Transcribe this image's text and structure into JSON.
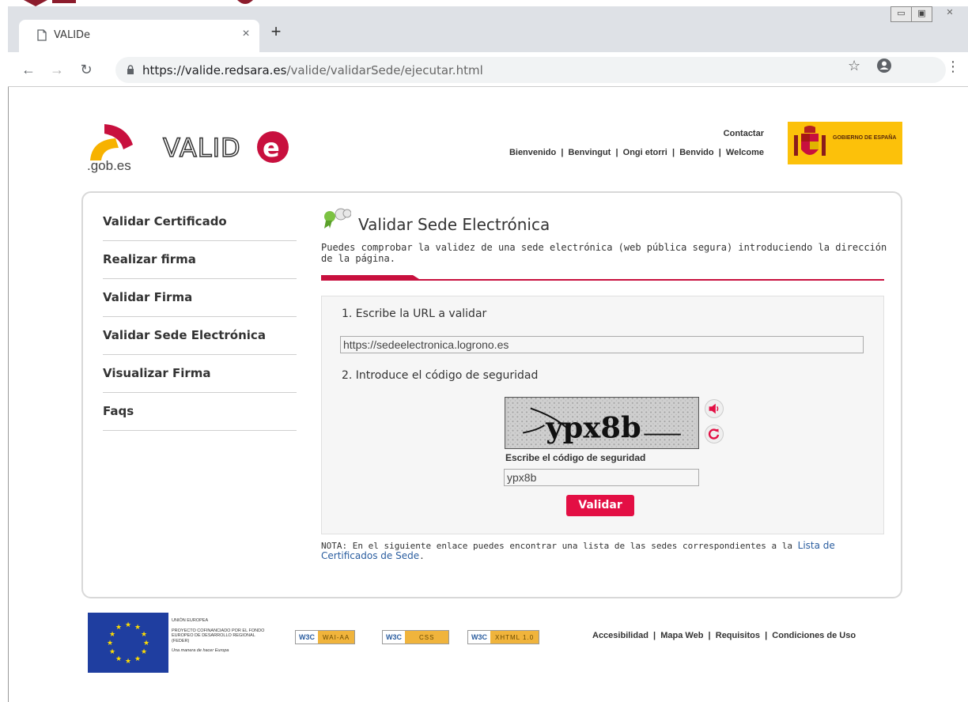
{
  "browser": {
    "tab_title": "VALIDe",
    "tab_close": "×",
    "new_tab": "+",
    "url_host": "https://valide.redsara.es",
    "url_path": "/valide/validarSede/ejecutar.html",
    "window_controls": {
      "minimize": "▭",
      "maximize": "▣",
      "close": "✕"
    }
  },
  "header": {
    "logo_suffix": ".gob.es",
    "logo_text": "VALIDe",
    "contact": "Contactar",
    "languages": [
      "Bienvenido",
      "Benvingut",
      "Ongi etorri",
      "Benvido",
      "Welcome"
    ],
    "government_badge": "GOBIERNO DE ESPAÑA"
  },
  "sidebar": {
    "items": [
      {
        "label": "Validar Certificado"
      },
      {
        "label": "Realizar firma"
      },
      {
        "label": "Validar Firma"
      },
      {
        "label": "Validar Sede Electrónica"
      },
      {
        "label": "Visualizar Firma"
      },
      {
        "label": "Faqs"
      }
    ]
  },
  "main": {
    "title": "Validar Sede Electrónica",
    "intro": "Puedes comprobar la validez de una sede electrónica (web pública segura) introduciendo la dirección de la página.",
    "step1": "1. Escribe la URL a validar",
    "url_value": "https://sedeelectronica.logrono.es",
    "step2": "2. Introduce el código de seguridad",
    "captcha_text": "ypx8b",
    "captcha_label": "Escribe el código de seguridad",
    "captcha_value": "ypx8b",
    "submit": "Validar",
    "note_prefix": "NOTA: En el siguiente enlace puedes encontrar una lista de las sedes correspondientes a la ",
    "note_link": "Lista de Certificados de Sede",
    "note_suffix": "."
  },
  "footer": {
    "eu_title": "UNIÓN EUROPEA",
    "eu_body": "PROYECTO COFINANCIADO POR EL FONDO EUROPEO DE DESARROLLO REGIONAL (FEDER)",
    "eu_motto": "Una manera de hacer Europa",
    "w3c_badges": [
      "WAI-AA",
      "CSS",
      "XHTML 1.0"
    ],
    "links": [
      "Accesibilidad",
      "Mapa Web",
      "Requisitos",
      "Condiciones de Uso"
    ]
  },
  "colors": {
    "accent": "#e30f44",
    "rule": "#c8103e",
    "link": "#2a5d9f",
    "badge": "#fcc10a"
  }
}
